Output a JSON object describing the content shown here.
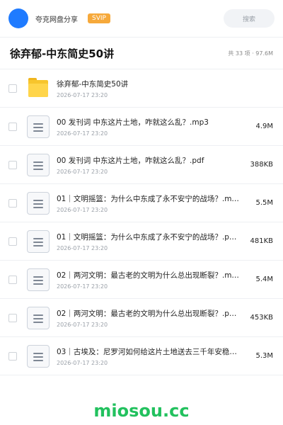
{
  "header": {
    "brand": "夸克网盘分享",
    "vip_badge": "SVIP",
    "search_placeholder": "搜索"
  },
  "title": {
    "text": "徐弃郁-中东简史50讲",
    "meta": "共 33 项 · 97.6M"
  },
  "files": [
    {
      "name": "徐弃郁-中东简史50讲",
      "date": "2026-07-17 23:20",
      "size": "",
      "type": "folder"
    },
    {
      "name": "00 发刊词  中东这片土地，咋就这么乱？.mp3",
      "date": "2026-07-17 23:20",
      "size": "4.9M",
      "type": "file"
    },
    {
      "name": "00 发刊词  中东这片土地，咋就这么乱？.pdf",
      "date": "2026-07-17 23:20",
      "size": "388KB",
      "type": "file"
    },
    {
      "name": "01｜文明摇篮：为什么中东成了永不安宁的战场？.m…",
      "date": "2026-07-17 23:20",
      "size": "5.5M",
      "type": "file"
    },
    {
      "name": "01｜文明摇篮：为什么中东成了永不安宁的战场？.p…",
      "date": "2026-07-17 23:20",
      "size": "481KB",
      "type": "file"
    },
    {
      "name": "02｜两河文明：最古老的文明为什么总出现断裂？.m…",
      "date": "2026-07-17 23:20",
      "size": "5.4M",
      "type": "file"
    },
    {
      "name": "02｜两河文明：最古老的文明为什么总出现断裂？.p…",
      "date": "2026-07-17 23:20",
      "size": "453KB",
      "type": "file"
    },
    {
      "name": "03｜古埃及：尼罗河如何给这片土地送去三千年安稳？…",
      "date": "2026-07-17 23:20",
      "size": "5.3M",
      "type": "file"
    }
  ],
  "footer": {
    "logo": "miosou.cc"
  },
  "colors": {
    "accent": "#1f7bff",
    "vip": "#f6a93b",
    "folder": "#ffd54a",
    "logo": "#22c15e"
  }
}
